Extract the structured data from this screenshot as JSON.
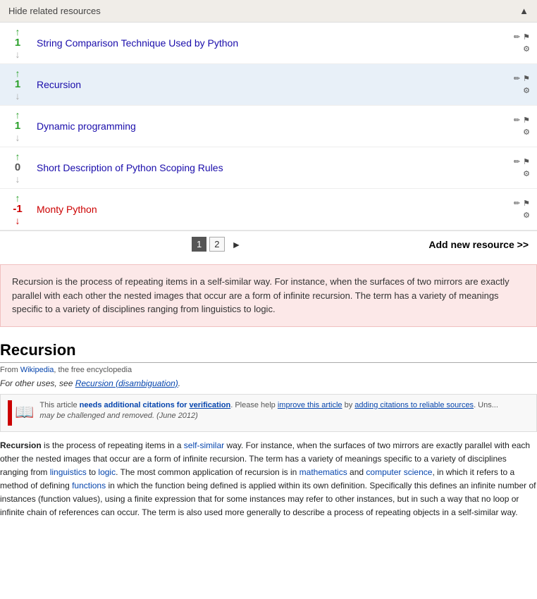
{
  "header": {
    "label": "Hide related resources",
    "triangle": "▲"
  },
  "resources": [
    {
      "id": "res-1",
      "vote_up": "↑",
      "vote_count": "1",
      "vote_count_class": "positive",
      "vote_down": "↓",
      "vote_down_class": "",
      "title": "String Comparison Technique Used by Python",
      "highlighted": false
    },
    {
      "id": "res-2",
      "vote_up": "↑",
      "vote_count": "1",
      "vote_count_class": "positive",
      "vote_down": "↓",
      "vote_down_class": "",
      "title": "Recursion",
      "highlighted": true
    },
    {
      "id": "res-3",
      "vote_up": "↑",
      "vote_count": "1",
      "vote_count_class": "positive",
      "vote_down": "↓",
      "vote_down_class": "",
      "title": "Dynamic programming",
      "highlighted": false
    },
    {
      "id": "res-4",
      "vote_up": "↑",
      "vote_count": "0",
      "vote_count_class": "zero",
      "vote_down": "↓",
      "vote_down_class": "",
      "title": "Short Description of Python Scoping Rules",
      "highlighted": false
    },
    {
      "id": "res-5",
      "vote_up": "↑",
      "vote_count": "-1",
      "vote_count_class": "negative",
      "vote_down": "↓",
      "vote_down_class": "active",
      "title": "Monty Python",
      "highlighted": false
    }
  ],
  "pagination": {
    "add_new_label": "Add new resource >>",
    "pages": [
      "1",
      "2"
    ],
    "active_page": "1",
    "next_arrow": "►"
  },
  "description": {
    "text": "Recursion is the process of repeating items in a self-similar way. For instance, when the surfaces of two mirrors are exactly parallel with each other the nested images that occur are a form of infinite recursion. The term has a variety of meanings specific to a variety of disciplines ranging from linguistics to logic."
  },
  "wiki": {
    "title": "Recursion",
    "source_text": "From Wikipedia, the free encyclopedia",
    "source_link_text": "Wikipedia",
    "disambiguation_text": "For other uses, see ",
    "disambiguation_link": "Recursion (disambiguation)",
    "notice_text": "This article needs additional citations for ",
    "notice_bold": "verification",
    "notice_rest": ". Please help improve this article by adding citations to reliable sources. Uns...",
    "notice_italics": "may be challenged and removed. (June 2012)",
    "body_html": "<p><strong>Recursion</strong> is the process of repeating items in a <a href='#'>self-similar</a> way. For instance, when the surfaces of two mirrors are exactly parallel with each other the nested images that occur are a form of infinite recursion. The term has a variety of meanings specific to a variety of disciplines ranging from <a href='#'>linguistics</a> to <a href='#'>logic</a>. The most common application of recursion is in <a href='#'>mathematics</a> and <a href='#'>computer science</a>, in which it refers to a method of defining <a href='#'>functions</a> in which the function being defined is applied within its own definition. Specifically this defines an infinite number of instances (function values), using a finite expression that for some instances may refer to other instances, but in such a way that no loop or infinite chain of references can occur. The term is also used more generally to describe a process of repeating objects in a self-similar way.</p>"
  }
}
